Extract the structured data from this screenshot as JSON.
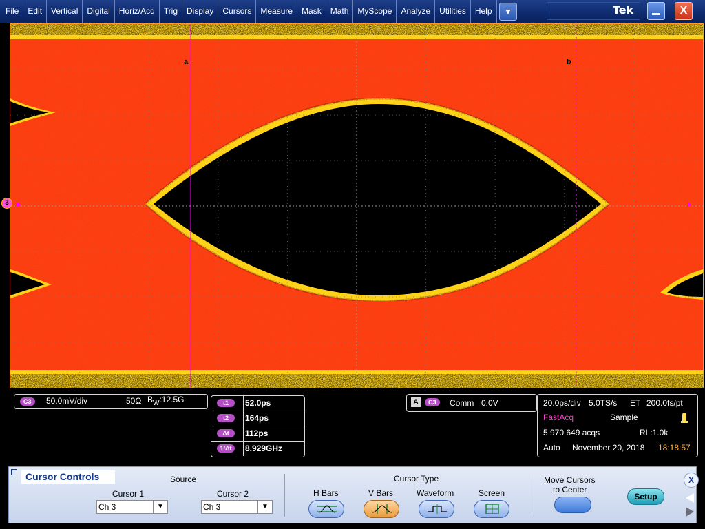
{
  "menu": {
    "items": [
      "File",
      "Edit",
      "Vertical",
      "Digital",
      "Horiz/Acq",
      "Trig",
      "Display",
      "Cursors",
      "Measure",
      "Mask",
      "Math",
      "MyScope",
      "Analyze",
      "Utilities",
      "Help"
    ],
    "dropdown_icon": "chevron-down-icon",
    "brand": "Tek"
  },
  "waveform": {
    "cursor_a_label": "a",
    "cursor_b_label": "b",
    "channel_marker": "3",
    "cursor_color": "#ff00ff",
    "border_color": "#ff9a2a"
  },
  "vertical": {
    "channel": "C3",
    "scale": "50.0mV/div",
    "termination": "50Ω",
    "bw_b": "B",
    "bw_w": "W",
    "bandwidth": ":12.5G"
  },
  "cursor_readout": {
    "rows": [
      {
        "label": "t1",
        "value": "52.0ps"
      },
      {
        "label": "t2",
        "value": "164ps"
      },
      {
        "label": "Δt",
        "value": "112ps"
      },
      {
        "label": "1/Δt",
        "value": "8.929GHz"
      }
    ]
  },
  "trigger": {
    "mode": "A",
    "channel": "C3",
    "coupling": "Comm",
    "level": "0.0V"
  },
  "acquisition": {
    "timebase": "20.0ps/div",
    "sample_rate": "5.0TS/s",
    "et": "ET",
    "resolution": "200.0fs/pt",
    "mode": "FastAcq",
    "sampling": "Sample",
    "acqs": "5 970 649 acqs",
    "record_length": "RL:1.0k",
    "trigger_mode": "Auto",
    "date": "November 20, 2018",
    "time": "18:18:57",
    "accent_color": "#ff3cc8",
    "time_color": "#ffb347"
  },
  "cursor_controls": {
    "title": "Cursor Controls",
    "source_label": "Source",
    "cursor1_label": "Cursor 1",
    "cursor1_value": "Ch 3",
    "cursor2_label": "Cursor 2",
    "cursor2_value": "Ch 3",
    "type_label": "Cursor Type",
    "types": [
      "H Bars",
      "V Bars",
      "Waveform",
      "Screen"
    ],
    "active_type": "V Bars",
    "move_label_1": "Move Cursors",
    "move_label_2": "to Center",
    "setup_label": "Setup",
    "close_label": "X"
  }
}
